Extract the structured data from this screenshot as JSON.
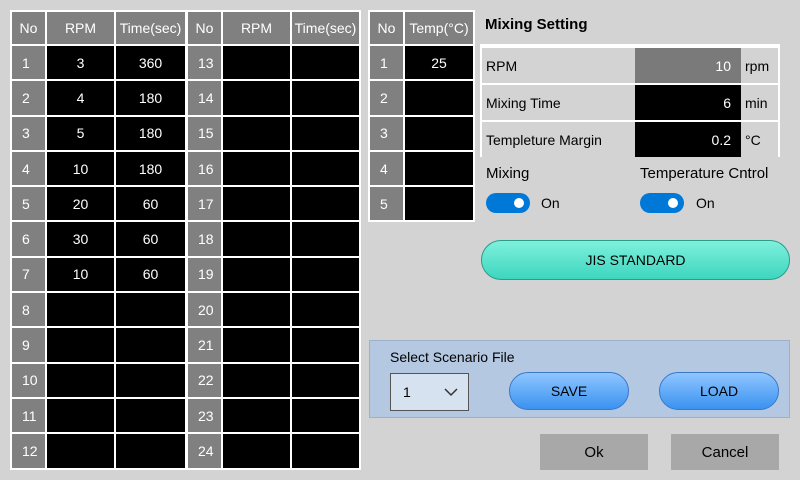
{
  "table1": {
    "headers": [
      "No",
      "RPM",
      "Time(sec)"
    ],
    "rows": [
      {
        "no": "1",
        "rpm": "3",
        "time": "360"
      },
      {
        "no": "2",
        "rpm": "4",
        "time": "180"
      },
      {
        "no": "3",
        "rpm": "5",
        "time": "180"
      },
      {
        "no": "4",
        "rpm": "10",
        "time": "180"
      },
      {
        "no": "5",
        "rpm": "20",
        "time": "60"
      },
      {
        "no": "6",
        "rpm": "30",
        "time": "60"
      },
      {
        "no": "7",
        "rpm": "10",
        "time": "60"
      },
      {
        "no": "8",
        "rpm": "",
        "time": ""
      },
      {
        "no": "9",
        "rpm": "",
        "time": ""
      },
      {
        "no": "10",
        "rpm": "",
        "time": ""
      },
      {
        "no": "11",
        "rpm": "",
        "time": ""
      },
      {
        "no": "12",
        "rpm": "",
        "time": ""
      }
    ]
  },
  "table2": {
    "headers": [
      "No",
      "RPM",
      "Time(sec)"
    ],
    "rows": [
      {
        "no": "13",
        "rpm": "",
        "time": ""
      },
      {
        "no": "14",
        "rpm": "",
        "time": ""
      },
      {
        "no": "15",
        "rpm": "",
        "time": ""
      },
      {
        "no": "16",
        "rpm": "",
        "time": ""
      },
      {
        "no": "17",
        "rpm": "",
        "time": ""
      },
      {
        "no": "18",
        "rpm": "",
        "time": ""
      },
      {
        "no": "19",
        "rpm": "",
        "time": ""
      },
      {
        "no": "20",
        "rpm": "",
        "time": ""
      },
      {
        "no": "21",
        "rpm": "",
        "time": ""
      },
      {
        "no": "22",
        "rpm": "",
        "time": ""
      },
      {
        "no": "23",
        "rpm": "",
        "time": ""
      },
      {
        "no": "24",
        "rpm": "",
        "time": ""
      }
    ]
  },
  "table3": {
    "headers": [
      "No",
      "Temp(°C)"
    ],
    "rows": [
      {
        "no": "1",
        "temp": "25"
      },
      {
        "no": "2",
        "temp": ""
      },
      {
        "no": "3",
        "temp": ""
      },
      {
        "no": "4",
        "temp": ""
      },
      {
        "no": "5",
        "temp": ""
      }
    ]
  },
  "mixing_setting": {
    "title": "Mixing Setting",
    "rows": [
      {
        "label": "RPM",
        "value": "10",
        "unit": "rpm"
      },
      {
        "label": "Mixing Time",
        "value": "6",
        "unit": "min"
      },
      {
        "label": "Templeture Margin",
        "value": "0.2",
        "unit": "°C"
      }
    ]
  },
  "toggles": {
    "mixing": {
      "label": "Mixing",
      "state": "On",
      "on": true
    },
    "temperature": {
      "label": "Temperature Cntrol",
      "state": "On",
      "on": true
    }
  },
  "jis_button": "JIS STANDARD",
  "scenario": {
    "label": "Select Scenario File",
    "selected": "1",
    "save_label": "SAVE",
    "load_label": "LOAD"
  },
  "dialog": {
    "ok_label": "Ok",
    "cancel_label": "Cancel"
  },
  "colors": {
    "background": "#d3d3d3",
    "toggle_on": "#0078d7",
    "jis_button": "#3dd6bf",
    "pill_button": "#3a92f0",
    "scenario_panel": "#b4c8e2"
  }
}
